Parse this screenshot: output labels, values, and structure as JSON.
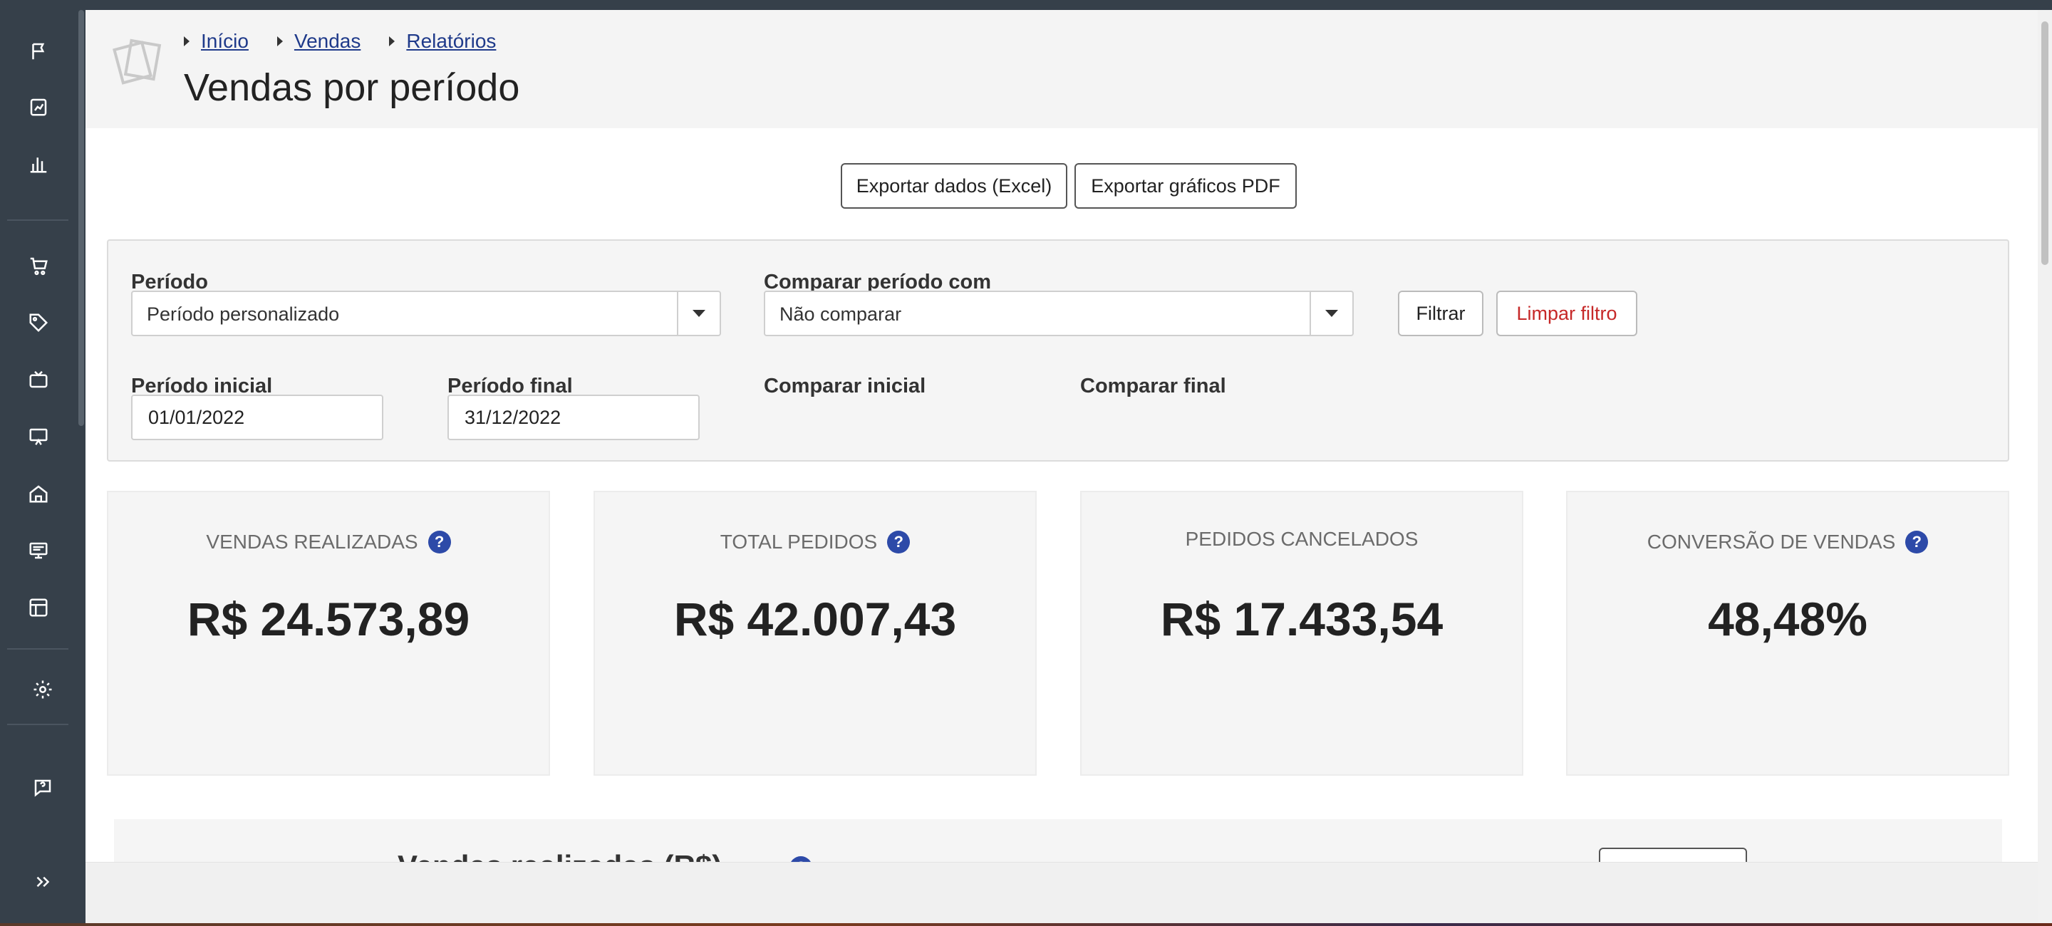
{
  "breadcrumb": [
    "Início",
    "Vendas",
    "Relatórios"
  ],
  "page_title": "Vendas por período",
  "actions": {
    "export_excel": "Exportar dados (Excel)",
    "export_pdf": "Exportar gráficos PDF"
  },
  "filters": {
    "period_label": "Período",
    "period_value": "Período personalizado",
    "compare_label": "Comparar período com",
    "compare_value": "Não comparar",
    "filter_button": "Filtrar",
    "clear_button": "Limpar filtro",
    "start_label": "Período inicial",
    "start_value": "01/01/2022",
    "end_label": "Período final",
    "end_value": "31/12/2022",
    "compare_start_label": "Comparar inicial",
    "compare_end_label": "Comparar final"
  },
  "cards": [
    {
      "title": "VENDAS REALIZADAS",
      "value": "R$ 24.573,89",
      "help": "?"
    },
    {
      "title": "TOTAL PEDIDOS",
      "value": "R$ 42.007,43",
      "help": "?"
    },
    {
      "title": "PEDIDOS CANCELADOS",
      "value": "R$ 17.433,54"
    },
    {
      "title": "CONVERSÃO DE VENDAS",
      "value": "48,48%",
      "help": "?"
    }
  ],
  "chart_section": {
    "title": "Vendas realizadas (R$)",
    "help": "?"
  },
  "colors": {
    "sidebar": "#36404a",
    "link": "#1f3a8a",
    "help_badge": "#2d4aa8",
    "danger": "#c62828"
  },
  "sidebar_icons": [
    "flag-icon",
    "clipboard-chart-icon",
    "bar-chart-icon",
    "cart-icon",
    "tag-icon",
    "tv-icon",
    "presentation-icon",
    "home-icon",
    "monitor-icon",
    "layout-icon",
    "gear-icon",
    "help-chat-icon",
    "expand-icon"
  ]
}
